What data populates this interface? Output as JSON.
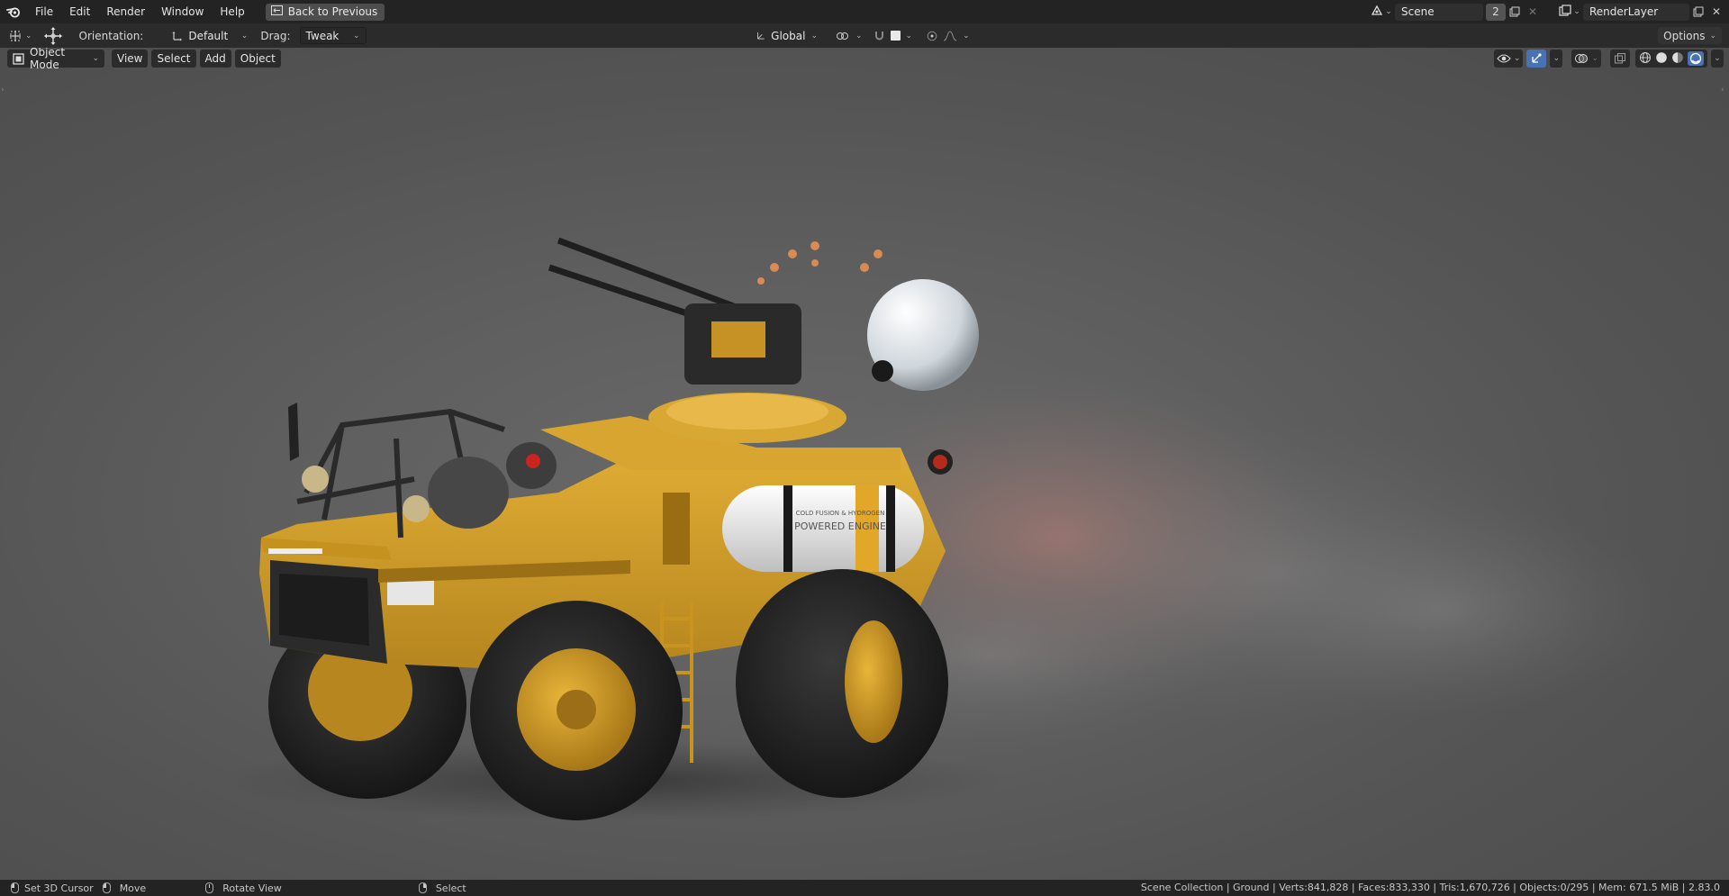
{
  "menubar": {
    "items": [
      "File",
      "Edit",
      "Render",
      "Window",
      "Help"
    ],
    "back_button": "Back to Previous",
    "scene_name": "Scene",
    "scene_users": "2",
    "view_layer": "RenderLayer"
  },
  "tool_header": {
    "orientation_label": "Orientation:",
    "orientation_value": "Default",
    "drag_label": "Drag:",
    "drag_value": "Tweak",
    "transform_orientation": "Global",
    "options_label": "Options"
  },
  "viewport": {
    "mode": "Object Mode",
    "menus": [
      "View",
      "Select",
      "Add",
      "Object"
    ],
    "tank_text_line1": "COLD FUSION & HYDROGEN",
    "tank_text_line2": "POWERED ENGINE"
  },
  "statusbar": {
    "hints": [
      "Set 3D Cursor",
      "Move",
      "Rotate View",
      "Select"
    ],
    "stats": "Scene Collection | Ground | Verts:841,828 | Faces:833,330 | Tris:1,670,726 | Objects:0/295 | Mem: 671.5 MiB | 2.83.0"
  },
  "colors": {
    "accent": "#4772b3",
    "vehicle_body": "#d4a12a",
    "background": "#5f5f5f"
  },
  "icons": [
    "blender-logo-icon",
    "back-to-previous-icon",
    "scene-icon",
    "new-scene-icon",
    "close-icon",
    "view-layer-icon",
    "move-tool-icon",
    "transform-pivot-icon",
    "snap-icon",
    "proportional-edit-icon",
    "object-mode-icon",
    "visibility-icon",
    "gizmo-icon",
    "overlay-icon",
    "xray-icon",
    "wireframe-shading-icon",
    "solid-shading-icon",
    "material-shading-icon",
    "rendered-shading-icon"
  ]
}
